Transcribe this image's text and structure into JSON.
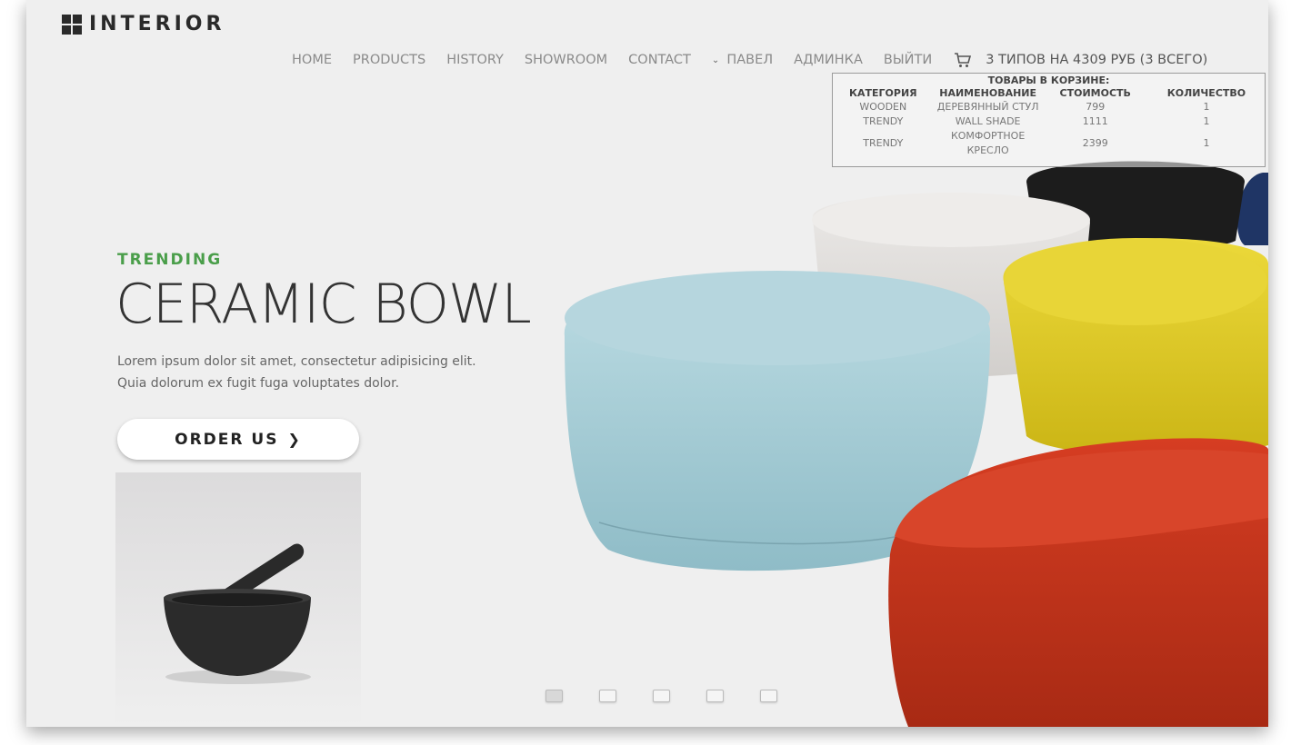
{
  "brand": {
    "name": "INTERIOR"
  },
  "nav": {
    "items": [
      "HOME",
      "PRODUCTS",
      "HISTORY",
      "SHOWROOM",
      "CONTACT"
    ],
    "user": "ПАВЕЛ",
    "admin": "АДМИНКА",
    "logout": "ВЫЙТИ",
    "cart_summary": "3 ТИПОВ НА 4309 РУБ (3 ВСЕГО)"
  },
  "cart": {
    "title": "ТОВАРЫ В КОРЗИНЕ:",
    "columns": [
      "КАТЕГОРИЯ",
      "НАИМЕНОВАНИЕ",
      "СТОИМОСТЬ",
      "КОЛИЧЕСТВО"
    ],
    "rows": [
      [
        "WOODEN",
        "ДЕРЕВЯННЫЙ СТУЛ",
        "799",
        "1"
      ],
      [
        "TRENDY",
        "WALL SHADE",
        "1111",
        "1"
      ],
      [
        "TRENDY",
        "КОМФОРТНОЕ КРЕСЛО",
        "2399",
        "1"
      ]
    ]
  },
  "hero": {
    "kicker": "TRENDING",
    "headline": "CERAMIC BOWL",
    "description": "Lorem ipsum dolor sit amet, consectetur adipisicing elit. Quia dolorum ex fugit fuga voluptates dolor.",
    "cta": "ORDER US"
  },
  "colors": {
    "accent": "#4a9e4a",
    "pouf_blue": "#a8cdd6",
    "pouf_yellow": "#e0cd2a",
    "pouf_red": "#c8331a",
    "pouf_white": "#e6e4e2",
    "pouf_black": "#1c1c1c",
    "pouf_navy": "#1f3565"
  },
  "pagination": {
    "count": 5,
    "active": 0
  }
}
